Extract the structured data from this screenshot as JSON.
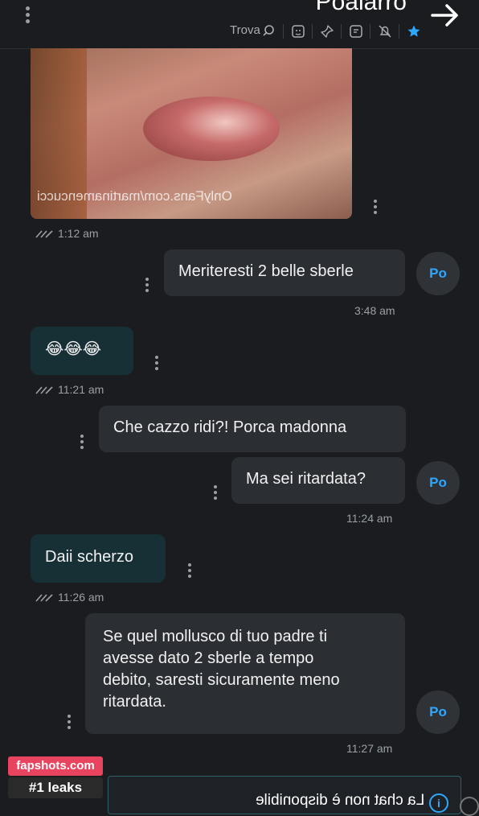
{
  "header": {
    "title": "Poalarro",
    "search_label": "Trova",
    "icons": [
      "star-icon",
      "mute-bell-icon",
      "note-icon",
      "pin-icon",
      "sticker-icon",
      "search-icon"
    ]
  },
  "image_message": {
    "watermark": "OnlyFans.com/martinamencucci",
    "time": "1:12 am"
  },
  "messages": [
    {
      "side": "right",
      "text": "Meriteresti 2 belle sberle",
      "time": "3:48 am",
      "avatar": "Po"
    },
    {
      "side": "left",
      "text": "😂😂😂",
      "time": "11:21 am"
    },
    {
      "side": "right",
      "text": "Che cazzo ridi?! Porca madonna",
      "time": ""
    },
    {
      "side": "right",
      "text": "Ma sei ritardata?",
      "time": "11:24 am",
      "avatar": "Po"
    },
    {
      "side": "left",
      "text": "Daii scherzo",
      "time": "11:26 am"
    },
    {
      "side": "right",
      "lines": [
        "Se quel mollusco di tuo padre ti",
        "avesse dato 2 sberle a tempo",
        "debito, saresti sicuramente meno",
        "ritardata."
      ],
      "time": "11:27 am",
      "avatar": "Po"
    }
  ],
  "watermark_ad": {
    "line1": "fapshots.com",
    "line2": "#1 leaks"
  },
  "footer": {
    "text": "La chat non è disponibile"
  },
  "colors": {
    "accent": "#2ea8ff",
    "bubble_left": "#173036",
    "bubble_right": "#2b2e32",
    "background": "#1a1c1f"
  }
}
